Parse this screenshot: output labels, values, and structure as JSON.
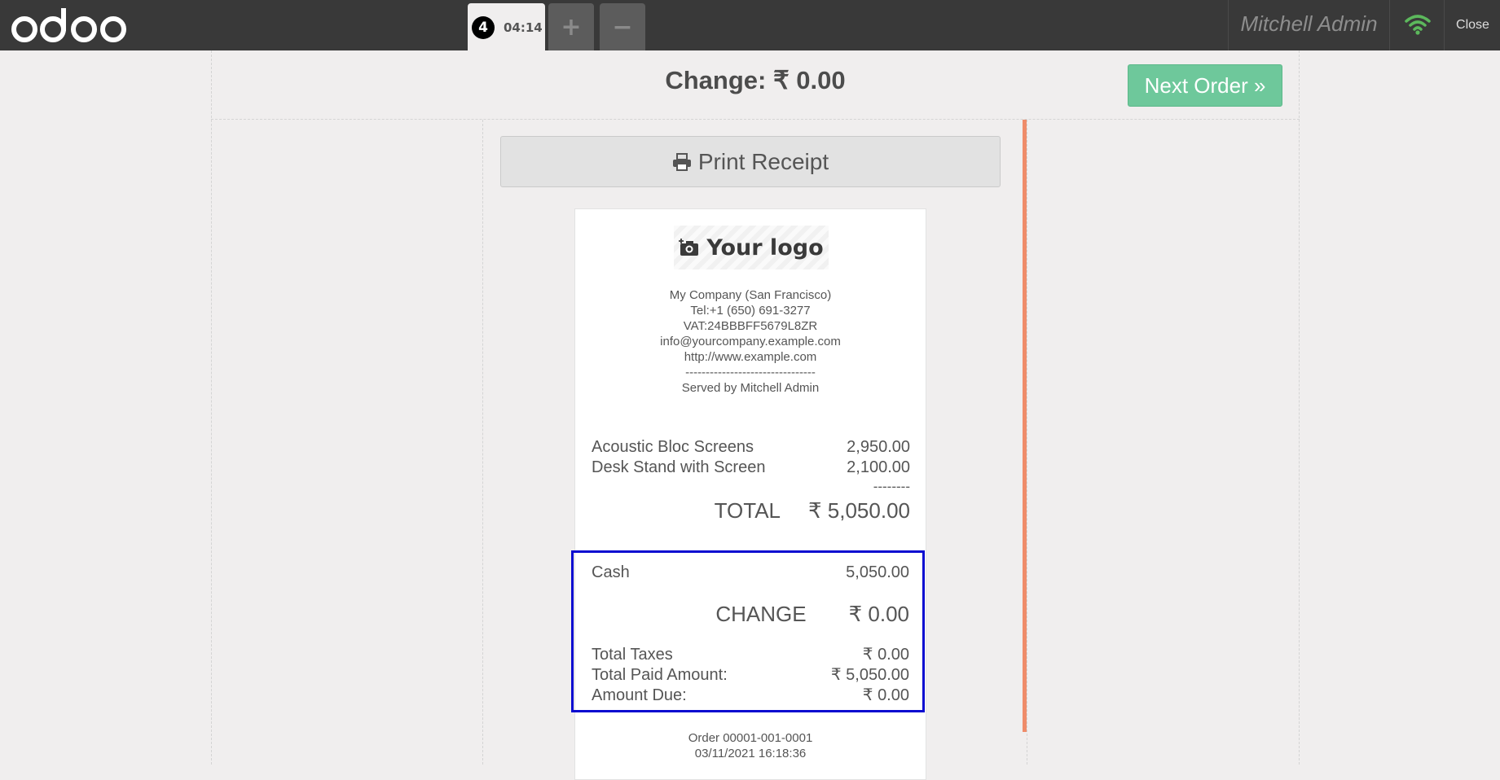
{
  "topbar": {
    "logo_text": "odoo",
    "order_tab": {
      "number": "4",
      "time": "04:14"
    },
    "add_order_label": "+",
    "remove_order_label": "−",
    "user": "Mitchell Admin",
    "close_label": "Close",
    "wifi_color": "#5cb85c"
  },
  "screen": {
    "change_title": "Change: ₹ 0.00",
    "next_order_label": "Next Order »",
    "print_receipt_label": "Print Receipt",
    "accent_color": "#6ec89b"
  },
  "receipt": {
    "logo_placeholder": "Your logo",
    "company_lines": [
      "My Company (San Francisco)",
      "Tel:+1 (650) 691-3277",
      "VAT:24BBBFF5679L8ZR",
      "info@yourcompany.example.com",
      "http://www.example.com",
      "--------------------------------",
      "Served by Mitchell Admin"
    ],
    "lines": [
      {
        "name": "Acoustic Bloc Screens",
        "price": "2,950.00"
      },
      {
        "name": "Desk Stand with Screen",
        "price": "2,100.00"
      }
    ],
    "separator": "--------",
    "total_label": "TOTAL",
    "total_value": "₹ 5,050.00",
    "payment": {
      "method": "Cash",
      "amount": "5,050.00"
    },
    "change_label": "CHANGE",
    "change_value": "₹ 0.00",
    "taxes": [
      {
        "label": "Total Taxes",
        "value": "₹ 0.00"
      },
      {
        "label": "Total Paid Amount:",
        "value": "₹ 5,050.00"
      },
      {
        "label": "Amount Due:",
        "value": "₹ 0.00"
      }
    ],
    "order_ref": "Order 00001-001-0001",
    "order_date": "03/11/2021 16:18:36"
  }
}
